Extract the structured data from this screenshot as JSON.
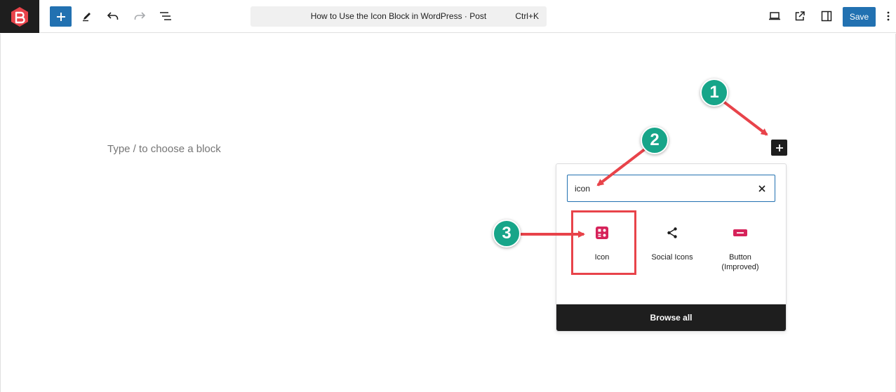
{
  "toolbar": {
    "add_block_label": "+",
    "document_title": "How to Use the Icon Block in WordPress · Post",
    "shortcut": "Ctrl+K",
    "save_label": "Save",
    "icons": [
      "logo-icon",
      "plus-icon",
      "pencil-icon",
      "undo-icon",
      "redo-icon",
      "list-view-icon",
      "desktop-preview-icon",
      "external-link-icon",
      "sidebar-toggle-icon",
      "more-options-icon"
    ]
  },
  "editor": {
    "placeholder": "Type / to choose a block"
  },
  "inserter": {
    "search_value": "icon",
    "results": [
      {
        "label": "Icon",
        "icon": "icon-block-icon",
        "color": "#d6225a"
      },
      {
        "label": "Social Icons",
        "icon": "share-icon",
        "color": "#1e1e1e"
      },
      {
        "label": "Button (Improved)",
        "icon": "button-icon",
        "color": "#d6225a"
      }
    ],
    "browse_all_label": "Browse all"
  },
  "annotations": {
    "steps": [
      "1",
      "2",
      "3"
    ],
    "badge_color": "#17a589",
    "arrow_color": "#e8434a"
  },
  "colors": {
    "accent": "#2271b1",
    "dark": "#1e1e1e"
  }
}
